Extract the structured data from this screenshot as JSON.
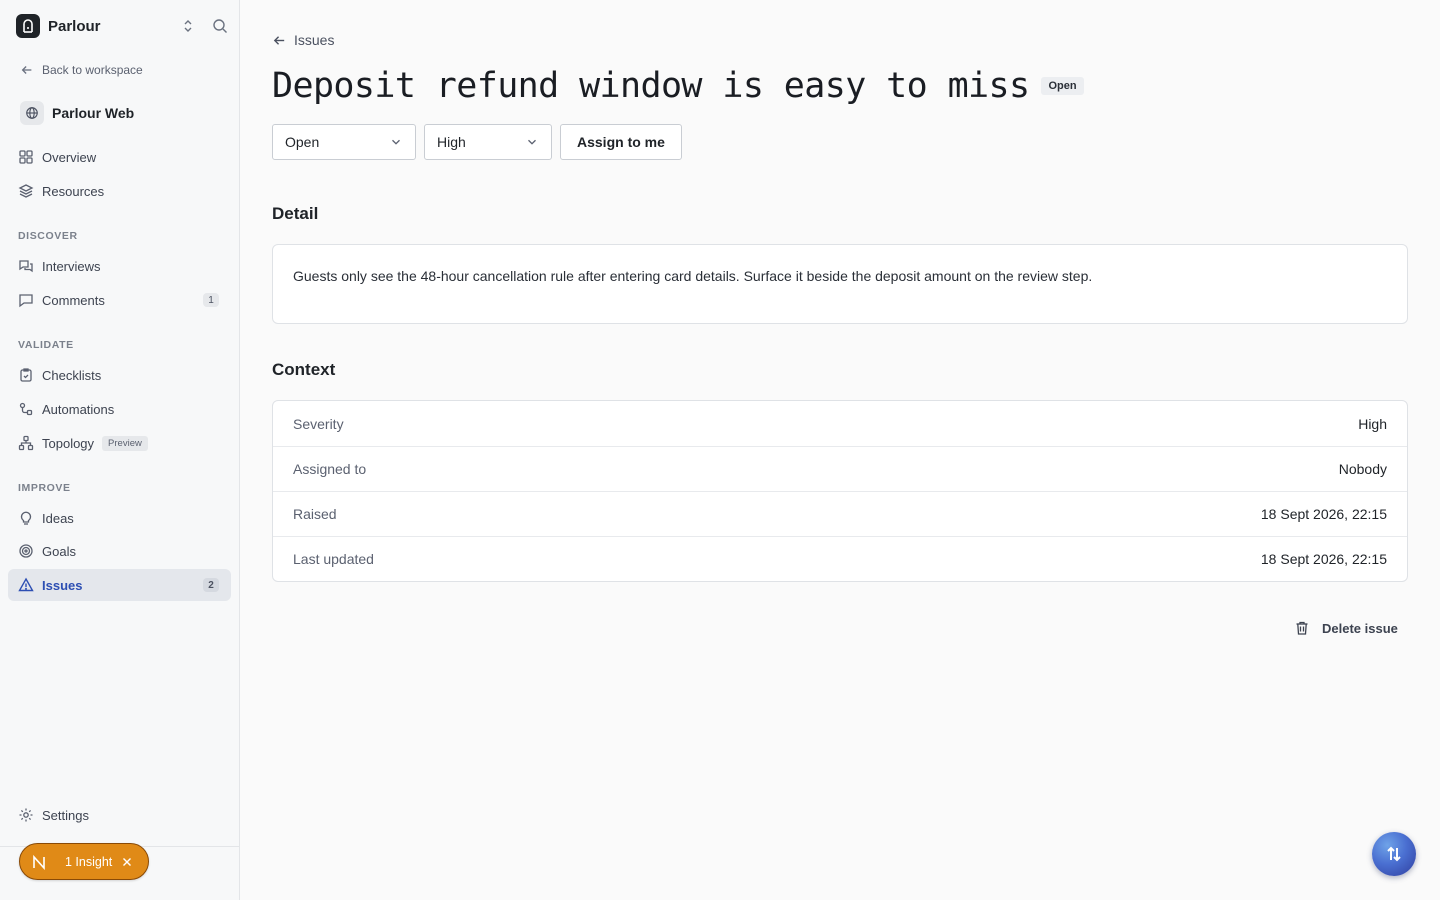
{
  "app": {
    "name": "Parlour"
  },
  "sidebar": {
    "back_label": "Back to workspace",
    "project_name": "Parlour Web",
    "items_top": [
      {
        "label": "Overview",
        "icon": "grid-icon"
      },
      {
        "label": "Resources",
        "icon": "layers-icon"
      }
    ],
    "sections": [
      {
        "label": "DISCOVER",
        "items": [
          {
            "label": "Interviews",
            "icon": "chat-bubbles-icon"
          },
          {
            "label": "Comments",
            "icon": "comment-icon",
            "count": "1"
          }
        ]
      },
      {
        "label": "VALIDATE",
        "items": [
          {
            "label": "Checklists",
            "icon": "clipboard-check-icon"
          },
          {
            "label": "Automations",
            "icon": "workflow-icon"
          },
          {
            "label": "Topology",
            "icon": "network-icon",
            "tag": "Preview"
          }
        ]
      },
      {
        "label": "IMPROVE",
        "items": [
          {
            "label": "Ideas",
            "icon": "lightbulb-icon"
          },
          {
            "label": "Goals",
            "icon": "target-icon"
          },
          {
            "label": "Issues",
            "icon": "warning-icon",
            "count": "2",
            "active": true
          }
        ]
      }
    ],
    "settings_label": "Settings",
    "insight_label": "1 Insight"
  },
  "issue": {
    "breadcrumb": "Issues",
    "title": "Deposit refund window is easy to miss",
    "status_badge": "Open",
    "status_select": "Open",
    "severity_select": "High",
    "assign_button": "Assign to me",
    "detail_heading": "Detail",
    "detail_text": "Guests only see the 48-hour cancellation rule after entering card details. Surface it beside the deposit amount on the review step.",
    "context_heading": "Context",
    "context": [
      {
        "key": "Severity",
        "value": "High"
      },
      {
        "key": "Assigned to",
        "value": "Nobody"
      },
      {
        "key": "Raised",
        "value": "18 Sept 2026, 22:15"
      },
      {
        "key": "Last updated",
        "value": "18 Sept 2026, 22:15"
      }
    ],
    "delete_label": "Delete issue"
  },
  "colors": {
    "accent": "#2d4fb3",
    "insight": "#e08a17"
  }
}
